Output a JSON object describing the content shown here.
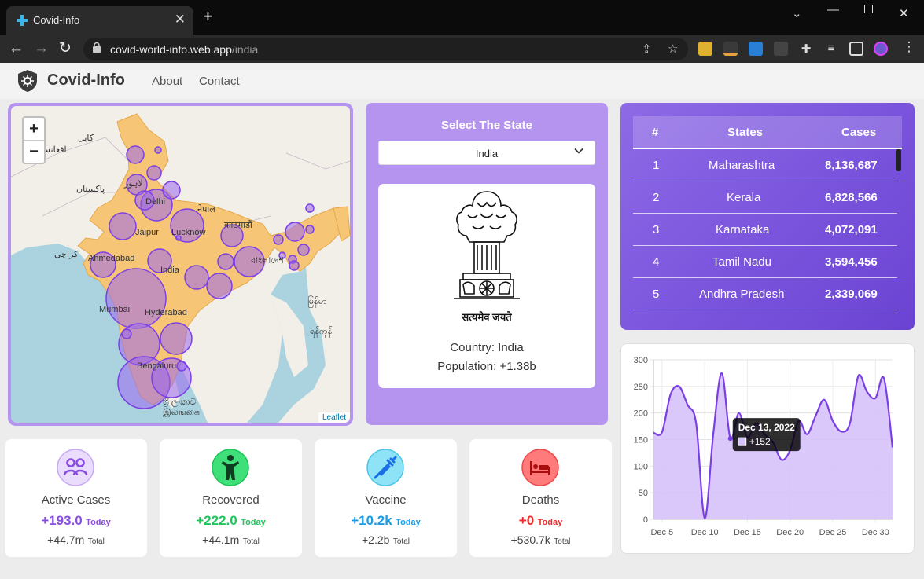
{
  "browser": {
    "tab_title": "Covid-Info",
    "url_host": "covid-world-info.web.app",
    "url_path": "/india"
  },
  "app": {
    "brand": "Covid-Info",
    "nav": [
      "About",
      "Contact"
    ]
  },
  "map": {
    "attribution": "Leaflet",
    "zoom_in": "+",
    "zoom_out": "−",
    "labels": {
      "kabul": "کابل",
      "afghanistan": "افغانستان",
      "pakistan": "پاکستان",
      "karachi": "کراچی",
      "delhi": "Delhi",
      "nepal": "नेपाल",
      "kathmandu": "काठमाडौं",
      "jaipur": "Jaipur",
      "lucknow": "Lucknow",
      "ahmedabad": "Ahmedabad",
      "india": "India",
      "bangladesh": "বাংলাদেশ",
      "myanmar": "မြန်မာ",
      "yangon": "ရန်ကုန်",
      "mumbai": "Mumbai",
      "hyderabad": "Hyderabad",
      "bengaluru": "Bengaluru",
      "srilanka_si": "ශ්‍රී ලංකාව",
      "srilanka_ta": "இலங்கை",
      "lahore": "لاہور"
    }
  },
  "state_select": {
    "title": "Select The State",
    "selected": "India",
    "motto": "सत्यमेव जयते",
    "country_line": "Country: India",
    "population_line": "Population: +1.38b"
  },
  "states_table": {
    "headers": [
      "#",
      "States",
      "Cases"
    ],
    "rows": [
      {
        "rank": "1",
        "state": "Maharashtra",
        "cases": "8,136,687"
      },
      {
        "rank": "2",
        "state": "Kerala",
        "cases": "6,828,566"
      },
      {
        "rank": "3",
        "state": "Karnataka",
        "cases": "4,072,091"
      },
      {
        "rank": "4",
        "state": "Tamil Nadu",
        "cases": "3,594,456"
      },
      {
        "rank": "5",
        "state": "Andhra Pradesh",
        "cases": "2,339,069"
      }
    ]
  },
  "stats": [
    {
      "label": "Active Cases",
      "today": "+193.0",
      "today_word": "Today",
      "total": "+44.7m",
      "total_word": "Total",
      "color": "#8a4fe0",
      "icon": "people-icon"
    },
    {
      "label": "Recovered",
      "today": "+222.0",
      "today_word": "Today",
      "total": "+44.1m",
      "total_word": "Total",
      "color": "#1fc45a",
      "icon": "person-icon"
    },
    {
      "label": "Vaccine",
      "today": "+10.2k",
      "today_word": "Today",
      "total": "+2.2b",
      "total_word": "Total",
      "color": "#1a9be6",
      "icon": "syringe-icon"
    },
    {
      "label": "Deaths",
      "today": "+0",
      "today_word": "Today",
      "total": "+530.7k",
      "total_word": "Total",
      "color": "#ee2a2a",
      "icon": "bed-icon"
    }
  ],
  "colors": {
    "accent": "#b594f0",
    "chart_line": "#7b3fe4",
    "chart_fill": "#d6c2fb"
  },
  "chart_data": {
    "type": "area",
    "x": [
      "Dec 4",
      "Dec 5",
      "Dec 6",
      "Dec 7",
      "Dec 8",
      "Dec 9",
      "Dec 10",
      "Dec 11",
      "Dec 12",
      "Dec 13",
      "Dec 14",
      "Dec 15",
      "Dec 16",
      "Dec 17",
      "Dec 18",
      "Dec 19",
      "Dec 20",
      "Dec 21",
      "Dec 22",
      "Dec 23",
      "Dec 24",
      "Dec 25",
      "Dec 26",
      "Dec 27",
      "Dec 28",
      "Dec 29",
      "Dec 30",
      "Dec 31",
      "Jan 1"
    ],
    "values": [
      163,
      164,
      235,
      250,
      215,
      180,
      2,
      160,
      275,
      152,
      200,
      155,
      180,
      160,
      145,
      112,
      130,
      185,
      160,
      195,
      225,
      185,
      165,
      180,
      270,
      240,
      228,
      265,
      135
    ],
    "xticks": [
      "Dec 5",
      "Dec 10",
      "Dec 15",
      "Dec 20",
      "Dec 25",
      "Dec 30"
    ],
    "yticks": [
      0,
      50,
      100,
      150,
      200,
      250,
      300
    ],
    "ylim": [
      0,
      300
    ],
    "tooltip": {
      "title": "Dec 13, 2022",
      "value": "+152"
    }
  }
}
